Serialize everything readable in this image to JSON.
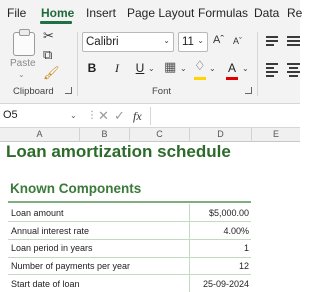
{
  "ribbon_tabs": [
    "File",
    "Home",
    "Insert",
    "Page Layout",
    "Formulas",
    "Data",
    "Re"
  ],
  "active_tab": "Home",
  "clipboard": {
    "paste_label": "Paste",
    "group_label": "Clipboard",
    "icons": [
      "paste-icon",
      "cut-icon",
      "copy-icon",
      "format-painter-icon"
    ]
  },
  "font": {
    "family": "Calibri",
    "size": "11",
    "group_label": "Font",
    "bold": "B",
    "italic": "I",
    "underline": "U",
    "fill_color": "#ffd400",
    "font_color": "#e00000"
  },
  "formula_bar": {
    "name_box": "O5",
    "fx_label": "fx",
    "value": ""
  },
  "columns": [
    "A",
    "B",
    "C",
    "D",
    "E"
  ],
  "sheet": {
    "title": "Loan amortization schedule",
    "section_title": "Known Components",
    "rows": [
      {
        "label": "Loan amount",
        "value": "$5,000.00"
      },
      {
        "label": "Annual interest rate",
        "value": "4.00%"
      },
      {
        "label": "Loan period in years",
        "value": "1"
      },
      {
        "label": "Number of payments per year",
        "value": "12"
      },
      {
        "label": "Start date of loan",
        "value": "25-09-2024"
      }
    ]
  },
  "colors": {
    "accent_green": "#1e7145",
    "title_green": "#2d6b2a",
    "section_green": "#3b7a3b"
  }
}
